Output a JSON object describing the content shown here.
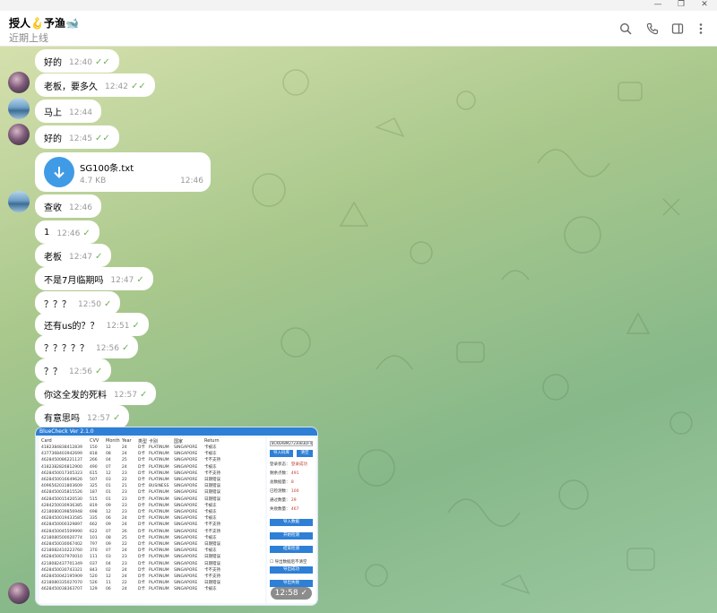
{
  "window": {
    "minimize": "—",
    "restore": "❐",
    "close": "✕"
  },
  "header": {
    "title": "授人🪝予渔🐋",
    "status": "近期上线"
  },
  "messages": [
    {
      "text": "好的",
      "time": "12:40",
      "ticks": "✓✓"
    },
    {
      "text": "老板，要多久",
      "time": "12:42",
      "ticks": "✓✓"
    },
    {
      "text": "马上",
      "time": "12:44",
      "ticks": ""
    },
    {
      "text": "好的",
      "time": "12:45",
      "ticks": "✓✓"
    },
    {
      "text": "查收",
      "time": "12:46",
      "ticks": ""
    },
    {
      "text": "1",
      "time": "12:46",
      "ticks": "✓"
    },
    {
      "text": "老板",
      "time": "12:47",
      "ticks": "✓"
    },
    {
      "text": "不是7月临期吗",
      "time": "12:47",
      "ticks": "✓"
    },
    {
      "text": "？？？",
      "time": "12:50",
      "ticks": "✓"
    },
    {
      "text": "还有us的？？",
      "time": "12:51",
      "ticks": "✓"
    },
    {
      "text": "？？？？？",
      "time": "12:56",
      "ticks": "✓"
    },
    {
      "text": "？？",
      "time": "12:56",
      "ticks": "✓"
    },
    {
      "text": "你这全发的死料",
      "time": "12:57",
      "ticks": "✓"
    },
    {
      "text": "有意思吗",
      "time": "12:57",
      "ticks": "✓"
    }
  ],
  "file": {
    "name": "SG100条.txt",
    "size": "4.7 KB",
    "time": "12:46"
  },
  "image": {
    "time": "12:58",
    "ticks": "✓",
    "app_title": "BlueCheck",
    "app_version": "Ver 2.1.0",
    "columns": [
      "Card",
      "CVV",
      "Month",
      "Year",
      "类型",
      "卡别",
      "国家",
      "Return"
    ],
    "rows": [
      [
        "4182384838412839",
        "150",
        "12",
        "24",
        "D卡",
        "PLATINUM",
        "SINGAPORE",
        "卡被冻"
      ],
      [
        "4377368403942699",
        "818",
        "08",
        "24",
        "D卡",
        "PLATINUM",
        "SINGAPORE",
        "卡被冻"
      ],
      [
        "4628450086221137",
        "266",
        "04",
        "25",
        "D卡",
        "PLATINUM",
        "SINGAPORE",
        "卡不支持"
      ],
      [
        "4182382826812900",
        "490",
        "07",
        "24",
        "D卡",
        "PLATINUM",
        "SINGAPORE",
        "卡被冻"
      ],
      [
        "4628450017305323",
        "615",
        "12",
        "23",
        "D卡",
        "PLATINUM",
        "SINGAPORE",
        "卡不支持"
      ],
      [
        "4628450016649626",
        "507",
        "03",
        "22",
        "D卡",
        "PLATINUM",
        "SINGAPORE",
        "日期错误"
      ],
      [
        "4096562031803609",
        "325",
        "01",
        "21",
        "D卡",
        "BUSINESS",
        "SINGAPORE",
        "日期错误"
      ],
      [
        "4628450035815526",
        "187",
        "01",
        "23",
        "D卡",
        "PLATINUM",
        "SINGAPORE",
        "日期错误"
      ],
      [
        "4628450015420530",
        "515",
        "01",
        "23",
        "D卡",
        "PLATINUM",
        "SINGAPORE",
        "日期错误"
      ],
      [
        "4284250030936385",
        "819",
        "09",
        "23",
        "D卡",
        "PLATINUM",
        "SINGAPORE",
        "卡被冻"
      ],
      [
        "4218080039856948",
        "698",
        "12",
        "23",
        "D卡",
        "PLATINUM",
        "SINGAPORE",
        "卡被冻"
      ],
      [
        "4628450019433585",
        "335",
        "06",
        "24",
        "D卡",
        "PLATINUM",
        "SINGAPORE",
        "卡被冻"
      ],
      [
        "4628450000329897",
        "662",
        "09",
        "24",
        "D卡",
        "PLATINUM",
        "SINGAPORE",
        "卡不支持"
      ],
      [
        "4628450045509990",
        "622",
        "07",
        "26",
        "D卡",
        "PLATINUM",
        "SINGAPORE",
        "卡不支持"
      ],
      [
        "4218080500020774",
        "101",
        "08",
        "25",
        "D卡",
        "PLATINUM",
        "SINGAPORE",
        "卡被冻"
      ],
      [
        "4628450030067402",
        "797",
        "09",
        "22",
        "D卡",
        "PLATINUM",
        "SINGAPORE",
        "日期错误"
      ],
      [
        "4218082410223760",
        "370",
        "07",
        "24",
        "D卡",
        "PLATINUM",
        "SINGAPORE",
        "卡被冻"
      ],
      [
        "4628450037970010",
        "111",
        "03",
        "23",
        "D卡",
        "PLATINUM",
        "SINGAPORE",
        "日期错误"
      ],
      [
        "4218082437701349",
        "037",
        "04",
        "23",
        "D卡",
        "PLATINUM",
        "SINGAPORE",
        "日期错误"
      ],
      [
        "4628450030743321",
        "843",
        "02",
        "24",
        "D卡",
        "PLATINUM",
        "SINGAPORE",
        "卡不支持"
      ],
      [
        "4628450042195909",
        "520",
        "12",
        "24",
        "D卡",
        "PLATINUM",
        "SINGAPORE",
        "卡不支持"
      ],
      [
        "4218080335027070",
        "526",
        "11",
        "22",
        "D卡",
        "PLATINUM",
        "SINGAPORE",
        "日期错误"
      ],
      [
        "4628450038363707",
        "129",
        "06",
        "24",
        "D卡",
        "PLATINUM",
        "SINGAPORE",
        "卡被冻"
      ]
    ],
    "side": {
      "input": "8CK6A8M27230B3DF4B6A8",
      "btn_import": "导入码库",
      "btn_clear": "清空",
      "stats": [
        {
          "label": "登录状态：",
          "value": "登录成功"
        },
        {
          "label": "剩余点数：",
          "value": "491"
        },
        {
          "label": "总数据量：",
          "value": "8"
        },
        {
          "label": "已检测数：",
          "value": "100"
        },
        {
          "label": "通过数量：",
          "value": "29"
        },
        {
          "label": "失败数量：",
          "value": "467"
        }
      ],
      "buttons": [
        "导入数据",
        "开始检测",
        "结束检测",
        "导出成功",
        "导出失败"
      ],
      "checkbox": "导出数据后不清空"
    }
  }
}
